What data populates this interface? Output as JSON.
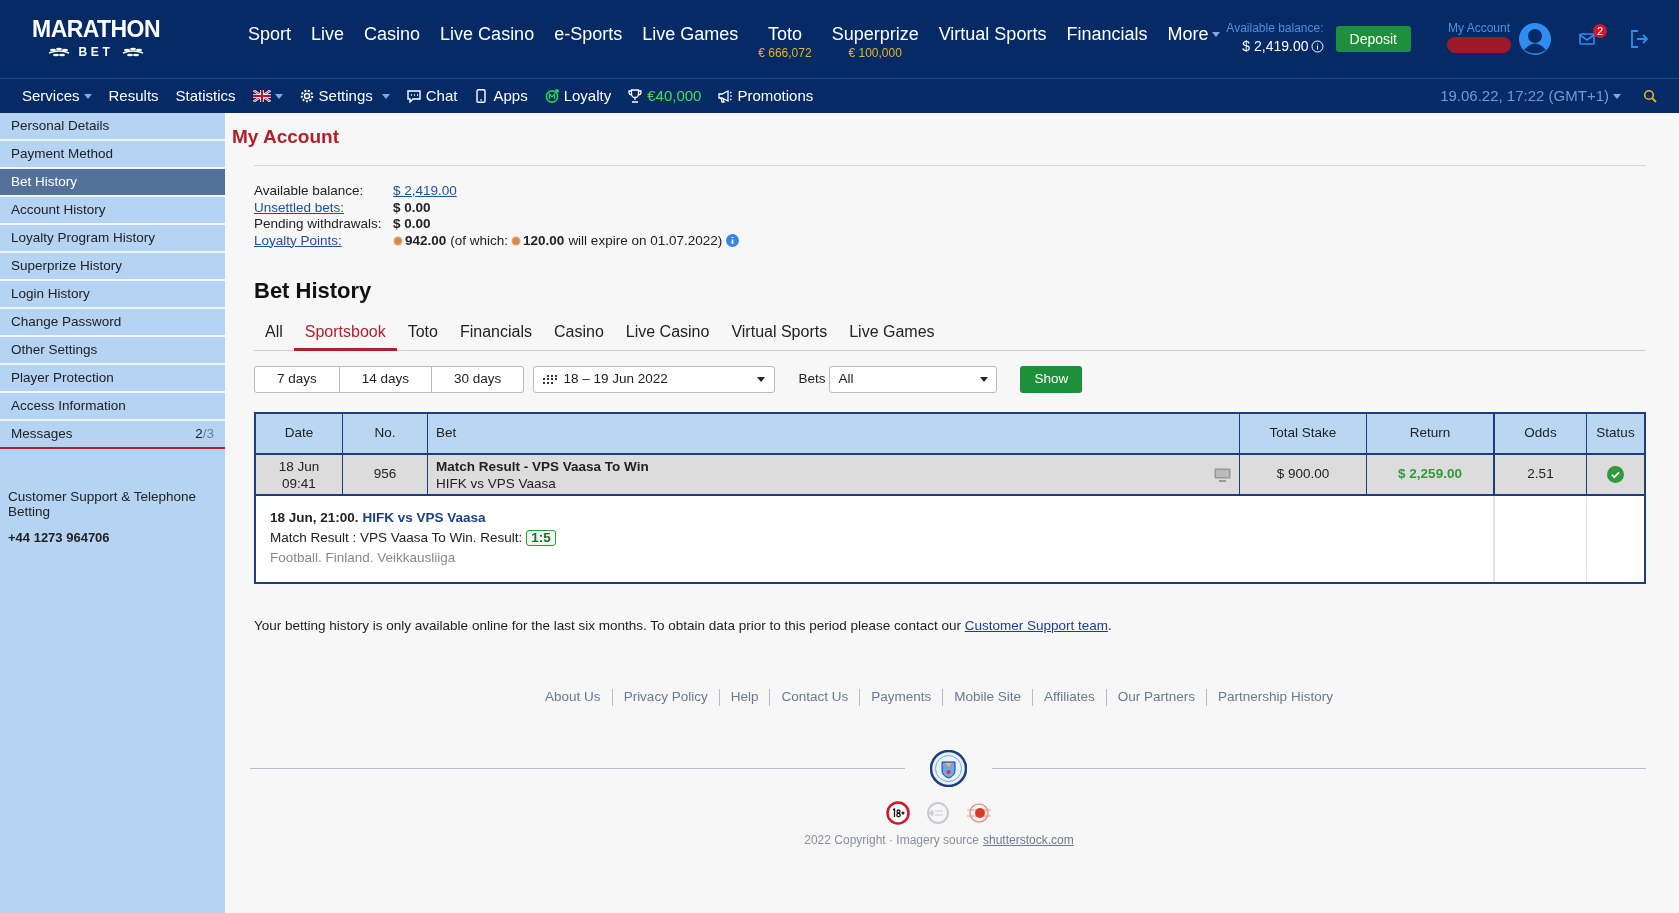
{
  "header": {
    "logo": {
      "line1": "MARATHON",
      "line2": "BET"
    },
    "main_nav": [
      {
        "label": "Sport"
      },
      {
        "label": "Live"
      },
      {
        "label": "Casino"
      },
      {
        "label": "Live Casino"
      },
      {
        "label": "e-Sports"
      },
      {
        "label": "Live Games"
      },
      {
        "label": "Toto",
        "jackpot": "€ 666,072"
      },
      {
        "label": "Superprize",
        "jackpot": "€ 100,000"
      },
      {
        "label": "Virtual Sports"
      },
      {
        "label": "Financials"
      },
      {
        "label": "More",
        "dropdown": true
      }
    ],
    "balance_label": "Available balance:",
    "balance": "$ 2,419.00",
    "deposit": "Deposit",
    "account_label": "My Account",
    "messages_badge": "2"
  },
  "subnav": {
    "items": [
      {
        "kind": "menu",
        "label": "Services"
      },
      {
        "kind": "link",
        "label": "Results"
      },
      {
        "kind": "link",
        "label": "Statistics"
      },
      {
        "kind": "flag"
      },
      {
        "kind": "settings",
        "label": "Settings"
      },
      {
        "kind": "chat",
        "label": "Chat"
      },
      {
        "kind": "apps",
        "label": "Apps"
      },
      {
        "kind": "loyalty",
        "label": "Loyalty"
      },
      {
        "kind": "prize",
        "label": "€40,000"
      },
      {
        "kind": "promotions",
        "label": "Promotions"
      }
    ],
    "datetime": "19.06.22, 17:22 (GMT+1)"
  },
  "sidebar": {
    "items": [
      {
        "label": "Personal Details",
        "selected": false
      },
      {
        "label": "Payment Method",
        "selected": false
      },
      {
        "label": "Bet History",
        "selected": true
      },
      {
        "label": "Account History",
        "selected": false
      },
      {
        "label": "Loyalty Program History",
        "selected": false
      },
      {
        "label": "Superprize History",
        "selected": false
      },
      {
        "label": "Login History",
        "selected": false
      },
      {
        "label": "Change Password",
        "selected": false
      },
      {
        "label": "Other Settings",
        "selected": false
      },
      {
        "label": "Player Protection",
        "selected": false
      },
      {
        "label": "Access Information",
        "selected": false
      },
      {
        "label": "Messages",
        "selected": false,
        "count": "2",
        "total": "/3"
      }
    ],
    "support_title": "Customer Support & Telephone Betting",
    "support_phone": "+44 1273 964706"
  },
  "page_title": "My Account",
  "summary": [
    {
      "kind": "plain",
      "label": "Available balance:",
      "value": "$ 2,419.00",
      "value_link": true
    },
    {
      "kind": "link",
      "label": "Unsettled bets:",
      "value": "$ 0.00"
    },
    {
      "kind": "plain",
      "label": "Pending withdrawals:",
      "value": "$ 0.00"
    },
    {
      "kind": "points",
      "label": "Loyalty Points:",
      "points": "942.00",
      "of_which": "(of which:",
      "expiring": "120.00",
      "expiry": "will expire on 01.07.2022)"
    }
  ],
  "bet_history": {
    "title": "Bet History",
    "tabs": [
      {
        "label": "All",
        "selected": false
      },
      {
        "label": "Sportsbook",
        "selected": true
      },
      {
        "label": "Toto",
        "selected": false
      },
      {
        "label": "Financials",
        "selected": false
      },
      {
        "label": "Casino",
        "selected": false
      },
      {
        "label": "Live Casino",
        "selected": false
      },
      {
        "label": "Virtual Sports",
        "selected": false
      },
      {
        "label": "Live Games",
        "selected": false
      }
    ],
    "periods": [
      "7 days",
      "14 days",
      "30 days"
    ],
    "date_range": "18 – 19 Jun 2022",
    "bets_label": "Bets",
    "bets_value": "All",
    "show": "Show"
  },
  "table": {
    "columns": [
      "Date",
      "No.",
      "Bet",
      "Total Stake",
      "Return",
      "Odds",
      "Status"
    ],
    "rows": [
      {
        "date": "18 Jun",
        "time": "09:41",
        "no": "956",
        "market": "Match Result - VPS Vaasa To Win",
        "event": "HIFK vs VPS Vaasa",
        "stake": "$ 900.00",
        "return": "$ 2,259.00",
        "odds": "2.51",
        "won": true,
        "detail": {
          "when": "18 Jun, 21:00.",
          "event": "HIFK vs VPS Vaasa",
          "result": "Match Result : VPS Vaasa To Win. Result:",
          "score": "1:5",
          "path": "Football. Finland. Veikkausliiga"
        }
      }
    ]
  },
  "note": {
    "text": "Your betting history is only available online for the last six months. To obtain data prior to this period please contact our",
    "link": "Customer Support team",
    "end": "."
  },
  "footer": {
    "links": [
      "About Us",
      "Privacy Policy",
      "Help",
      "Contact Us",
      "Payments",
      "Mobile Site",
      "Affiliates",
      "Our Partners",
      "Partnership History"
    ],
    "copyright": "2022 Copyright · Imagery source",
    "copyright_link": "shutterstock.com"
  }
}
